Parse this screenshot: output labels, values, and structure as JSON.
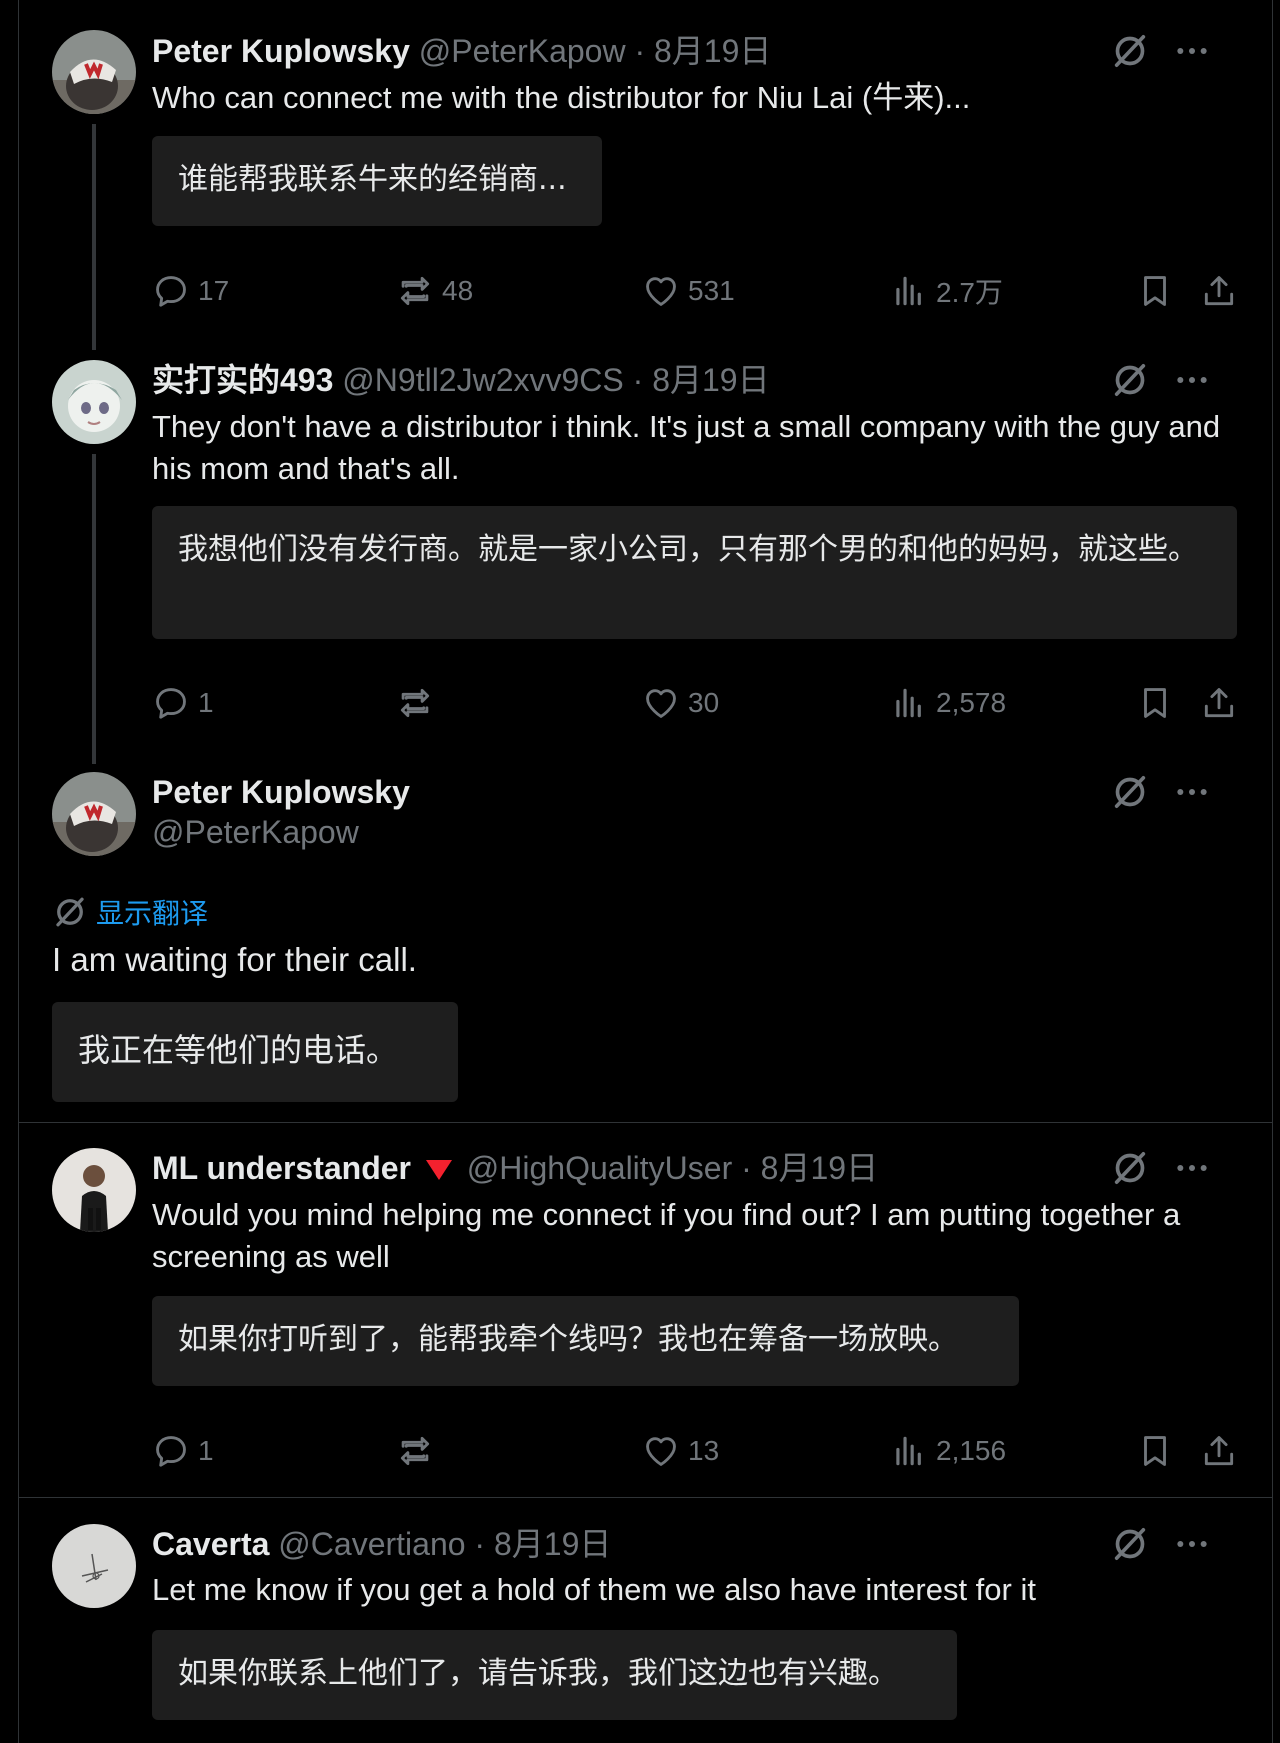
{
  "posts": [
    {
      "name": "Peter Kuplowsky",
      "handle": "@PeterKapow",
      "date": "· 8月19日",
      "text": "Who can connect me with the distributor for Niu Lai (牛来)...",
      "translation": "谁能帮我联系牛来的经销商...",
      "replies": "17",
      "reposts": "48",
      "likes": "531",
      "views": "2.7万"
    },
    {
      "name": "实打实的493",
      "handle": "@N9tll2Jw2xvv9CS",
      "date": "· 8月19日",
      "text": "They don't have a distributor i think. It's just a small company with the guy and his mom and that's all.",
      "translation": "我想他们没有发行商。就是一家小公司，只有那个男的和他的妈妈，就这些。",
      "replies": "1",
      "reposts": "",
      "likes": "30",
      "views": "2,578"
    },
    {
      "name": "Peter Kuplowsky",
      "handle": "@PeterKapow",
      "show_translation": "显示翻译",
      "text": "I am waiting for their call.",
      "translation": "我正在等他们的电话。"
    },
    {
      "name": "ML understander",
      "handle": "@HighQualityUser",
      "date": "· 8月19日",
      "text": "Would you mind helping me connect if you find out? I am putting together a screening as well",
      "translation": "如果你打听到了，能帮我牵个线吗？我也在筹备一场放映。",
      "replies": "1",
      "reposts": "",
      "likes": "13",
      "views": "2,156"
    },
    {
      "name": "Caverta",
      "handle": "@Cavertiano",
      "date": "· 8月19日",
      "text": "Let me know if you get a hold of them we also have interest for it",
      "translation": "如果你联系上他们了，请告诉我，我们这边也有兴趣。"
    }
  ],
  "colors": {
    "background": "#000000",
    "text": "#e7e9ea",
    "muted": "#71767b",
    "translation_box": "#1e1e1e",
    "link": "#1d9bf0",
    "badge": "#f4212e"
  },
  "icons": [
    "grok-translate-icon",
    "more-icon",
    "reply-icon",
    "repost-icon",
    "like-icon",
    "views-icon",
    "bookmark-icon",
    "share-icon"
  ]
}
